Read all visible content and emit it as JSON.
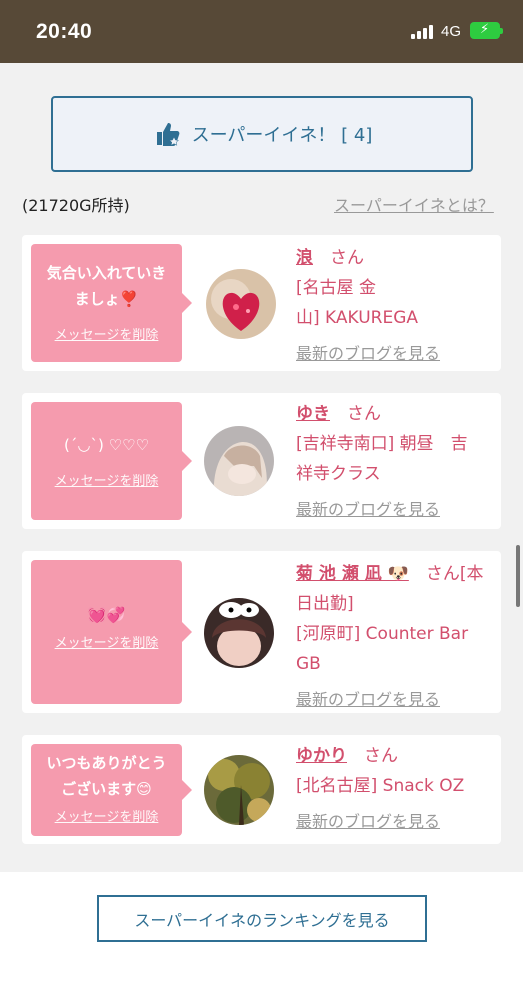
{
  "status": {
    "time": "20:40",
    "network": "4G"
  },
  "super_like": {
    "label": "スーパーイイネ！ [ 4]"
  },
  "coins_text": "(21720G所持)",
  "about_link": "スーパーイイネとは？",
  "delete_label": "メッセージを削除",
  "blog_label": "最新のブログを見る",
  "san_label": "さん",
  "cards": [
    {
      "msg1": "気合い入れていき",
      "msg2": "ましょ❣️",
      "name": "浪",
      "suffix": "",
      "shop1": "[名古屋 金",
      "shop2": "山] KAKUREGA"
    },
    {
      "msg1": "(ˊ◡ˋ) ♡♡♡",
      "name": "ゆき",
      "suffix": "",
      "shop1": "[吉祥寺南口] 朝昼　吉",
      "shop2": "祥寺クラス"
    },
    {
      "msg1": "💓💞",
      "name": "菊 池 瀬 凪 🐶",
      "suffix": "[本",
      "line2": "日出勤]",
      "shop1": "[河原町] Counter Bar",
      "shop2": "GB"
    },
    {
      "msg1": "いつもありがとう",
      "msg2": "ございます😊",
      "name": "ゆかり",
      "suffix": "",
      "shop1": "[北名古屋] Snack OZ"
    }
  ],
  "ranking_button": "スーパーイイネのランキングを見る",
  "colors": {
    "accent": "#2f6f93",
    "pink": "#f59bae",
    "name": "#d24f6d",
    "status_bar": "#574937"
  }
}
